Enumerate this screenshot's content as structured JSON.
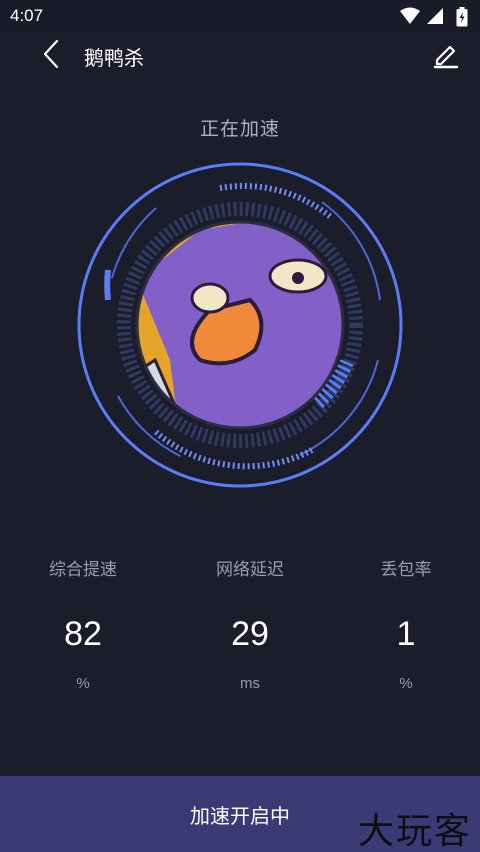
{
  "status_bar": {
    "time": "4:07",
    "icons": [
      "wifi-icon",
      "signal-icon",
      "battery-charging-icon"
    ]
  },
  "header": {
    "title": "鹅鸭杀",
    "back_icon": "chevron-left-icon",
    "edit_icon": "edit-pencil-icon"
  },
  "speed_status": "正在加速",
  "dial": {
    "ring_color": "#5b7cf7",
    "accent": "#3f5fe0",
    "image": "goose-duck-game-avatar"
  },
  "stats": [
    {
      "label": "综合提速",
      "value": "82",
      "unit": "%"
    },
    {
      "label": "网络延迟",
      "value": "29",
      "unit": "ms"
    },
    {
      "label": "丢包率",
      "value": "1",
      "unit": "%"
    }
  ],
  "bottom": {
    "label": "加速开启中",
    "watermark": "大玩客"
  },
  "colors": {
    "background": "#1c1d2b",
    "bottom_bar": "#3c3a75",
    "ring": "#5b7cf7"
  }
}
